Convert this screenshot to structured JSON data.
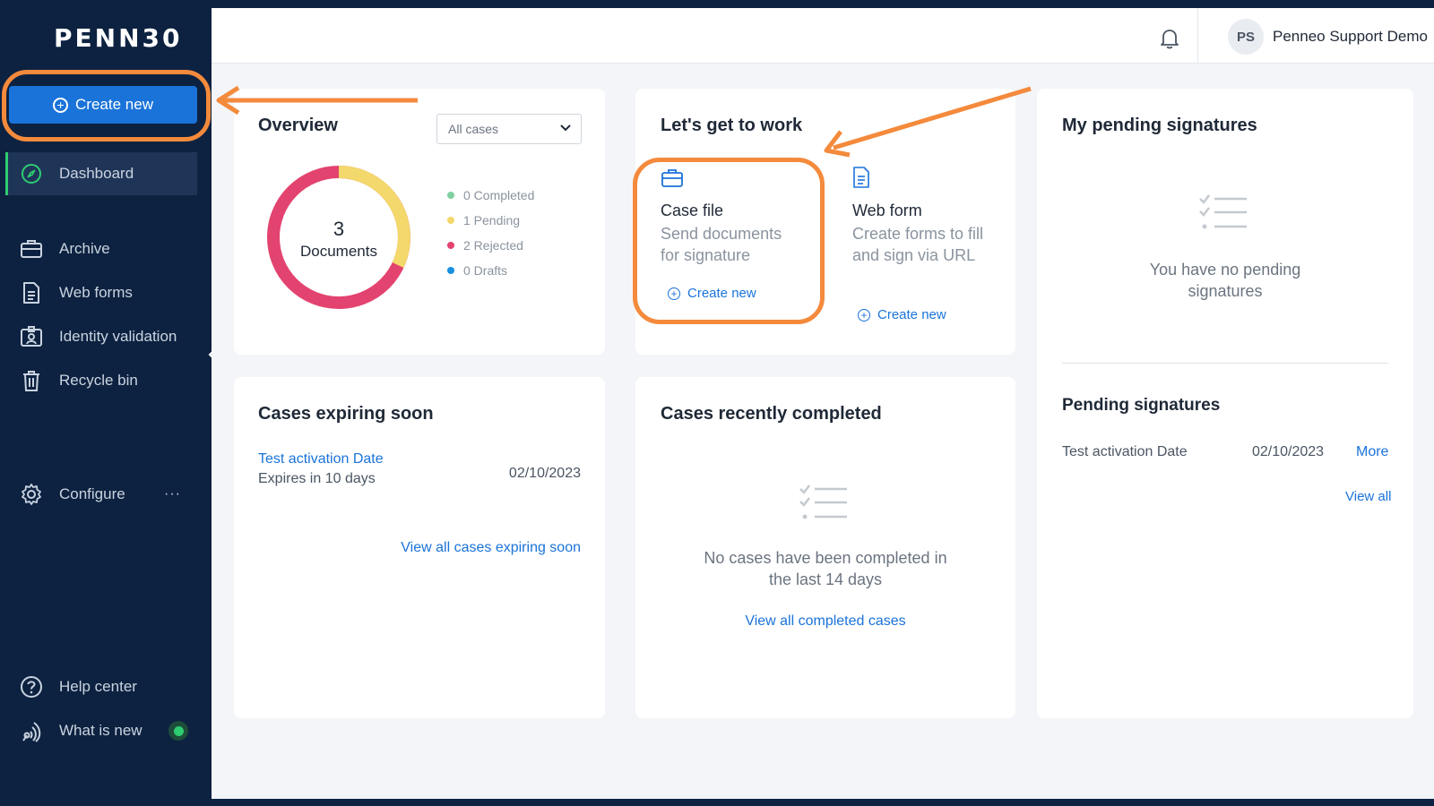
{
  "colors": {
    "sidebar_bg": "#0d2240",
    "primary": "#1a73d9",
    "annotation": "#f48a3c",
    "completed": "#7fd1a0",
    "pending": "#f3d86b",
    "rejected": "#e3436f",
    "drafts": "#1a8fe0"
  },
  "brand": {
    "logo": "PENN30"
  },
  "sidebar": {
    "create_new": "Create new",
    "items": [
      {
        "label": "Dashboard",
        "icon": "compass-icon"
      },
      {
        "label": "Archive",
        "icon": "briefcase-icon"
      },
      {
        "label": "Web forms",
        "icon": "document-icon"
      },
      {
        "label": "Identity validation",
        "icon": "id-badge-icon"
      },
      {
        "label": "Recycle bin",
        "icon": "trash-icon"
      }
    ],
    "configure": "Configure",
    "configure_more": "···",
    "help": "Help center",
    "whats_new": "What is new"
  },
  "header": {
    "avatar_initials": "PS",
    "user_name": "Penneo Support Demo"
  },
  "overview": {
    "title": "Overview",
    "filter": "All cases",
    "total": "3",
    "total_label": "Documents",
    "legend": [
      {
        "label": "0 Completed",
        "value": 0
      },
      {
        "label": "1 Pending",
        "value": 1
      },
      {
        "label": "2 Rejected",
        "value": 2
      },
      {
        "label": "0 Drafts",
        "value": 0
      }
    ]
  },
  "work": {
    "title": "Let's get to work",
    "case_file": {
      "title": "Case file",
      "desc": "Send documents for signature",
      "link": "Create new"
    },
    "web_form": {
      "title": "Web form",
      "desc": "Create forms to fill and sign via URL",
      "link": "Create new"
    }
  },
  "my_pending": {
    "title": "My pending signatures",
    "empty": "You have no pending signatures",
    "section_title": "Pending signatures",
    "row": {
      "name": "Test activation Date",
      "date": "02/10/2023",
      "more": "More"
    },
    "view_all": "View all"
  },
  "expiring": {
    "title": "Cases expiring soon",
    "item": {
      "name": "Test activation Date",
      "sub": "Expires in 10 days",
      "date": "02/10/2023"
    },
    "view_all": "View all cases expiring soon"
  },
  "completed": {
    "title": "Cases recently completed",
    "empty": "No cases have been completed in the last 14 days",
    "view_all": "View all completed cases"
  }
}
